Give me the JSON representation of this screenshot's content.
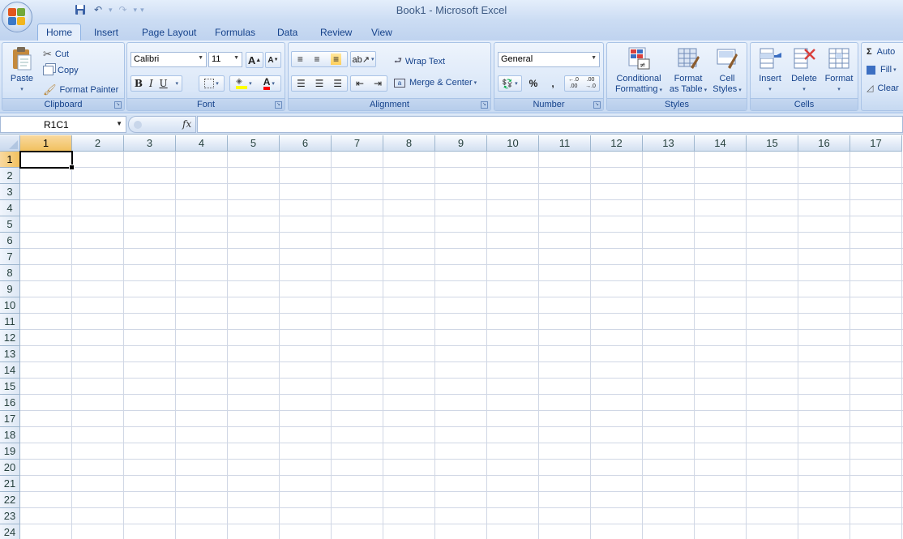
{
  "app": {
    "title": "Book1 - Microsoft Excel",
    "qat_separator": "▾"
  },
  "tabs": [
    "Home",
    "Insert",
    "Page Layout",
    "Formulas",
    "Data",
    "Review",
    "View"
  ],
  "ribbon": {
    "clipboard": {
      "label": "Clipboard",
      "paste": "Paste",
      "cut": "Cut",
      "copy": "Copy",
      "format_painter": "Format Painter"
    },
    "font": {
      "label": "Font",
      "font_name": "Calibri",
      "font_size": "11",
      "bold": "B",
      "italic": "I",
      "underline": "U",
      "grow": "A",
      "shrink": "A",
      "font_color": "A"
    },
    "alignment": {
      "label": "Alignment",
      "wrap_text": "Wrap Text",
      "merge_center": "Merge & Center"
    },
    "number": {
      "label": "Number",
      "format": "General",
      "percent": "%",
      "comma": ",",
      "inc_decimal": "←.0 .00",
      "dec_decimal": ".00 →.0"
    },
    "styles": {
      "label": "Styles",
      "conditional_1": "Conditional",
      "conditional_2": "Formatting",
      "format_table_1": "Format",
      "format_table_2": "as Table",
      "cell_styles_1": "Cell",
      "cell_styles_2": "Styles"
    },
    "cells": {
      "label": "Cells",
      "insert": "Insert",
      "delete": "Delete",
      "format": "Format"
    },
    "editing": {
      "autosum": "Auto",
      "fill": "Fill",
      "clear": "Clear"
    }
  },
  "formula_bar": {
    "name_box": "R1C1",
    "fx": "fx",
    "value": ""
  },
  "sheet": {
    "columns": [
      "1",
      "2",
      "3",
      "4",
      "5",
      "6",
      "7",
      "8",
      "9",
      "10",
      "11",
      "12",
      "13",
      "14",
      "15",
      "16",
      "17"
    ],
    "rows": [
      "1",
      "2",
      "3",
      "4",
      "5",
      "6",
      "7",
      "8",
      "9",
      "10",
      "11",
      "12",
      "13",
      "14",
      "15",
      "16",
      "17",
      "18",
      "19",
      "20",
      "21",
      "22",
      "23",
      "24"
    ],
    "selected_row": "1",
    "selected_column": "1"
  },
  "colors": {
    "accent": "#15428b",
    "selection_header": "#f1c15f",
    "gridline": "#d0d7e5"
  }
}
